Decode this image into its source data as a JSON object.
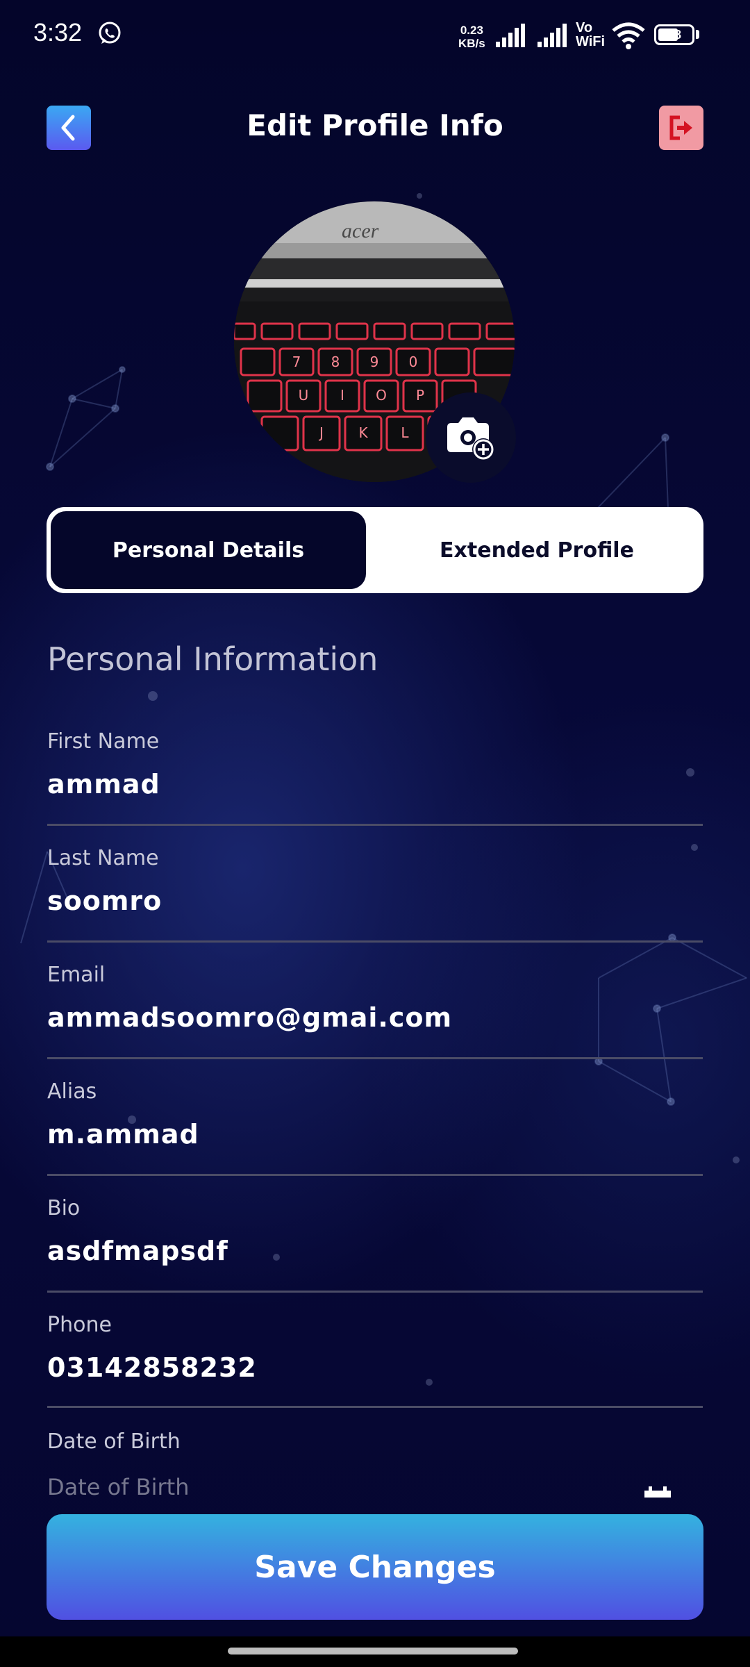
{
  "status_bar": {
    "time": "3:32",
    "speed_top": "0.23",
    "speed_bottom": "KB/s",
    "vowifi_top": "Vo",
    "vowifi_bottom": "WiFi",
    "battery_level": "58",
    "icons": [
      "whatsapp-icon",
      "signal-icon",
      "signal-icon",
      "wifi-icon",
      "battery-icon"
    ]
  },
  "header": {
    "title": "Edit Profile Info",
    "back_icon": "chevron-left-icon",
    "logout_icon": "logout-icon"
  },
  "avatar": {
    "logo_text": "acer",
    "keys_row1": [
      "7",
      "8",
      "9",
      "0"
    ],
    "keys_row2": [
      "U",
      "I",
      "O",
      "P"
    ],
    "keys_row3": [
      "J",
      "K",
      "L"
    ],
    "camera_icon": "camera-plus-icon"
  },
  "tabs": [
    {
      "label": "Personal Details",
      "active": true
    },
    {
      "label": "Extended Profile",
      "active": false
    }
  ],
  "section_title": "Personal Information",
  "fields": [
    {
      "label": "First Name",
      "value": "ammad"
    },
    {
      "label": "Last Name",
      "value": "soomro"
    },
    {
      "label": "Email",
      "value": "ammadsoomro@gmai.com"
    },
    {
      "label": "Alias",
      "value": "m.ammad"
    },
    {
      "label": "Bio",
      "value": "asdfmapsdf"
    },
    {
      "label": "Phone",
      "value": "03142858232"
    }
  ],
  "dob": {
    "label": "Date of Birth",
    "placeholder": "Date of Birth",
    "icon": "calendar-icon"
  },
  "save_button": "Save Changes",
  "colors": {
    "background": "#05062a",
    "accent_gradient_top": "#34b2e0",
    "accent_gradient_bottom": "#5050e2",
    "logout": "#f19aa3"
  }
}
